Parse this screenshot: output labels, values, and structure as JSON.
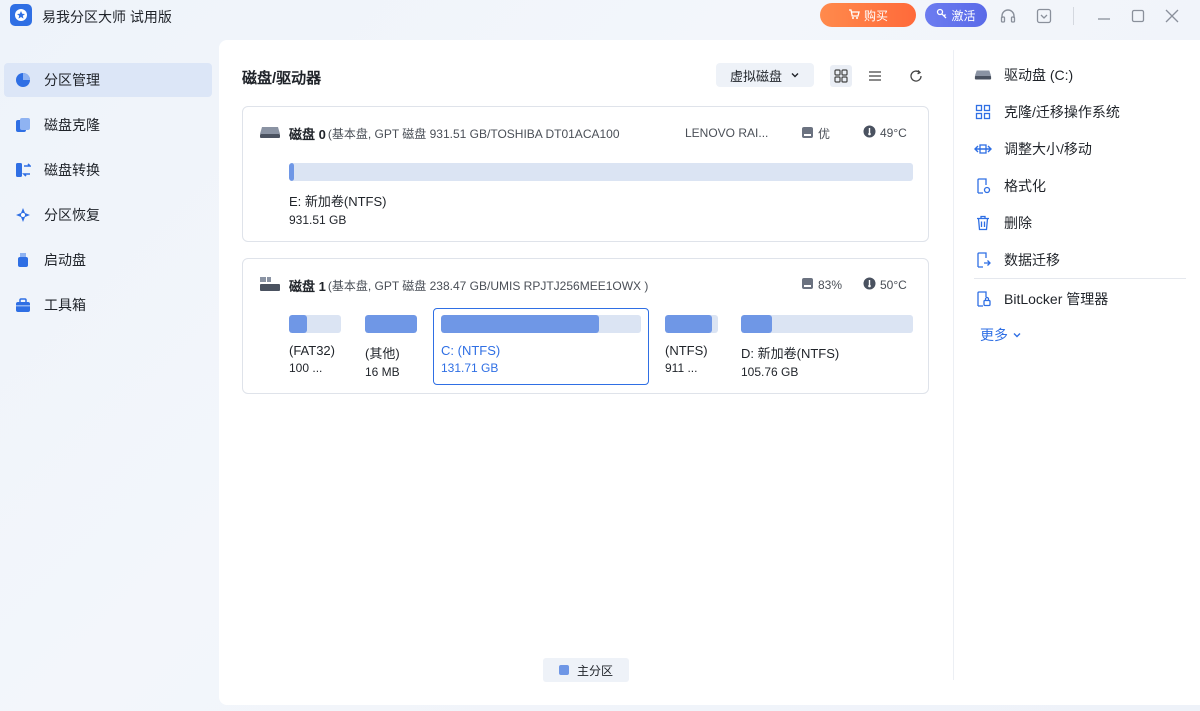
{
  "app": {
    "title": "易我分区大师 试用版"
  },
  "titlebar": {
    "buy_label": "购买",
    "activate_label": "激活"
  },
  "sidebar": {
    "items": [
      {
        "label": "分区管理",
        "icon": "pie-chart-icon"
      },
      {
        "label": "磁盘克隆",
        "icon": "clone-icon"
      },
      {
        "label": "磁盘转换",
        "icon": "convert-icon"
      },
      {
        "label": "分区恢复",
        "icon": "recover-icon"
      },
      {
        "label": "启动盘",
        "icon": "usb-icon"
      },
      {
        "label": "工具箱",
        "icon": "toolbox-icon"
      }
    ]
  },
  "main": {
    "title": "磁盘/驱动器",
    "virtual_disk_label": "虚拟磁盘",
    "legend_label": "主分区"
  },
  "disks": [
    {
      "name": "磁盘 0",
      "info": "(基本盘, GPT 磁盘 931.51 GB/TOSHIBA DT01ACA100",
      "model": "LENOVO RAI...",
      "health": "优",
      "temp": "49°C",
      "partitions": [
        {
          "label": "E: 新加卷(NTFS)",
          "size": "931.51 GB",
          "used": 0.005
        }
      ]
    },
    {
      "name": "磁盘 1",
      "info": "(基本盘, GPT 磁盘 238.47 GB/UMIS RPJTJ256MEE1OWX )",
      "health": "83%",
      "temp": "50°C",
      "partitions": [
        {
          "label": "(FAT32)",
          "size": "100 ...",
          "used": 0.35
        },
        {
          "label": "(其他)",
          "size": "16 MB",
          "used": 1.0
        },
        {
          "label": "C: (NTFS)",
          "size": "131.71 GB",
          "used": 0.79
        },
        {
          "label": "(NTFS)",
          "size": "911 ...",
          "used": 0.88
        },
        {
          "label": "D: 新加卷(NTFS)",
          "size": "105.76 GB",
          "used": 0.18
        }
      ]
    }
  ],
  "actions": {
    "drive_label": "驱动盘 (C:)",
    "clone_os": "克隆/迁移操作系统",
    "resize": "调整大小/移动",
    "format": "格式化",
    "delete": "删除",
    "migrate": "数据迁移",
    "bitlocker": "BitLocker 管理器",
    "more": "更多"
  },
  "colors": {
    "accent": "#2f6fe4",
    "partition_fill": "#6f97e6",
    "partition_track": "#dbe4f3"
  }
}
